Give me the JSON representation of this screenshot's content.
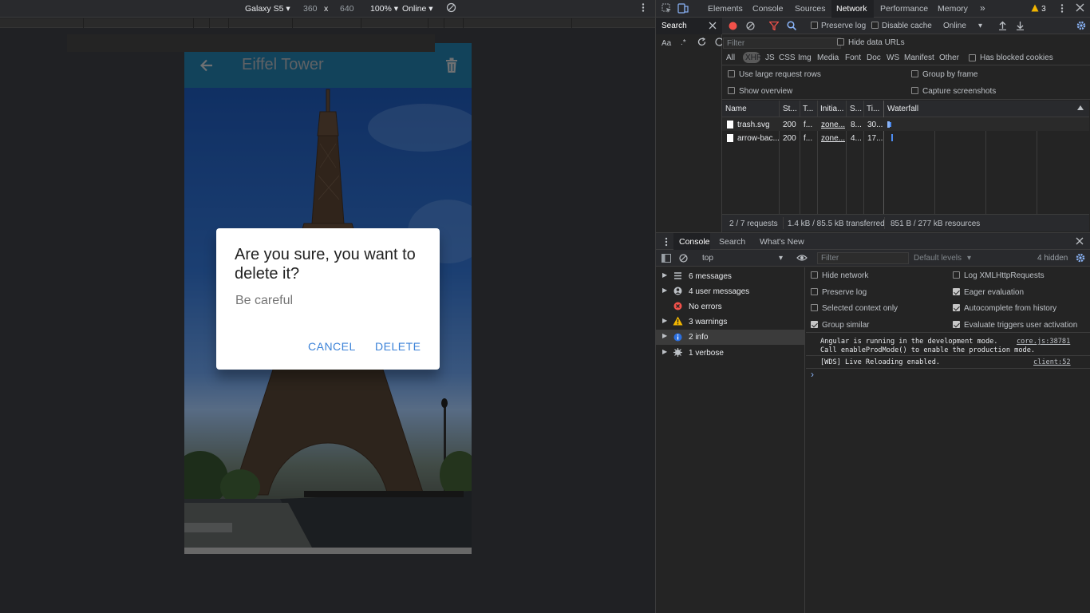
{
  "device_toolbar": {
    "device": "Galaxy S5",
    "width": "360",
    "times": "x",
    "height": "640",
    "zoom": "100%",
    "throttle": "Online"
  },
  "app": {
    "title": "Eiffel Tower",
    "dialog": {
      "title": "Are you sure, you want to delete it?",
      "body": "Be careful",
      "cancel": "CANCEL",
      "confirm": "DELETE"
    }
  },
  "devtools": {
    "tabs": [
      "Elements",
      "Console",
      "Sources",
      "Network",
      "Performance",
      "Memory"
    ],
    "active_tab": "Network",
    "more_tabs": "»",
    "warning_count": "3",
    "network": {
      "search_label": "Search",
      "preserve_log": "Preserve log",
      "disable_cache": "Disable cache",
      "throttle": "Online",
      "filter_placeholder": "Filter",
      "hide_data_urls": "Hide data URLs",
      "types": [
        "All",
        "XHR",
        "JS",
        "CSS",
        "Img",
        "Media",
        "Font",
        "Doc",
        "WS",
        "Manifest",
        "Other"
      ],
      "active_type": "XHR",
      "has_blocked_cookies": "Has blocked cookies",
      "use_large_rows": "Use large request rows",
      "group_by_frame": "Group by frame",
      "show_overview": "Show overview",
      "capture_screenshots": "Capture screenshots",
      "case_toggle": "Aa",
      "regex_toggle": ".*",
      "columns": [
        "Name",
        "St...",
        "T...",
        "Initia...",
        "S...",
        "Ti...",
        "Waterfall"
      ],
      "rows": [
        {
          "name": "trash.svg",
          "status": "200",
          "type": "f...",
          "initiator": "zone...",
          "size": "8...",
          "time": "30..."
        },
        {
          "name": "arrow-bac...",
          "status": "200",
          "type": "f...",
          "initiator": "zone...",
          "size": "4...",
          "time": "17..."
        }
      ],
      "summary": {
        "requests": "2 / 7 requests",
        "transferred": "1.4 kB / 85.5 kB transferred",
        "resources": "851 B / 277 kB resources"
      }
    },
    "drawer": {
      "tabs": [
        "Console",
        "Search",
        "What's New"
      ],
      "active_tab": "Console",
      "context": "top",
      "filter_placeholder": "Filter",
      "levels": "Default levels",
      "hidden": "4 hidden",
      "sidebar": [
        {
          "label": "6 messages",
          "icon": "list-icon"
        },
        {
          "label": "4 user messages",
          "icon": "user-icon"
        },
        {
          "label": "No errors",
          "icon": "error-icon"
        },
        {
          "label": "3 warnings",
          "icon": "warning-icon"
        },
        {
          "label": "2 info",
          "icon": "info-icon"
        },
        {
          "label": "1 verbose",
          "icon": "verbose-icon"
        }
      ],
      "active_item": "2 info",
      "settings": {
        "hide_network": "Hide network",
        "preserve_log": "Preserve log",
        "selected_context_only": "Selected context only",
        "group_similar": "Group similar",
        "log_xmlhttprequests": "Log XMLHttpRequests",
        "eager_evaluation": "Eager evaluation",
        "autocomplete_history": "Autocomplete from history",
        "evaluate_triggers": "Evaluate triggers user activation"
      },
      "messages": [
        {
          "lines": [
            "Angular is running in the development mode.",
            "Call enableProdMode() to enable the production mode."
          ],
          "source": "core.js:38781"
        },
        {
          "lines": [
            "[WDS] Live Reloading enabled."
          ],
          "source": "client:52"
        }
      ],
      "prompt": "›"
    }
  }
}
